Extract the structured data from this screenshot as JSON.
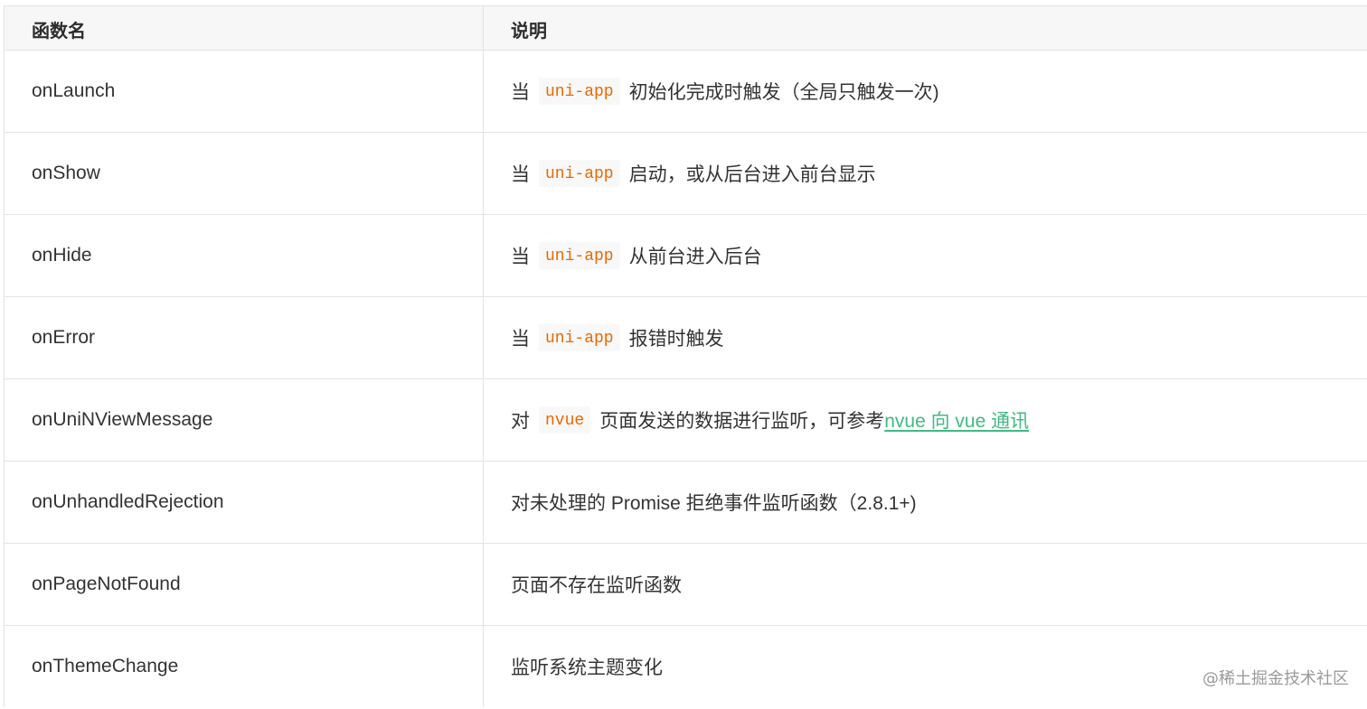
{
  "table": {
    "headers": {
      "name": "函数名",
      "desc": "说明"
    },
    "rows": [
      {
        "name": "onLaunch",
        "pre": "当",
        "code": "uni-app",
        "post": "初始化完成时触发（全局只触发一次)"
      },
      {
        "name": "onShow",
        "pre": "当",
        "code": "uni-app",
        "post": "启动，或从后台进入前台显示"
      },
      {
        "name": "onHide",
        "pre": "当",
        "code": "uni-app",
        "post": "从前台进入后台"
      },
      {
        "name": "onError",
        "pre": "当",
        "code": "uni-app",
        "post": "报错时触发"
      },
      {
        "name": "onUniNViewMessage",
        "pre": "对",
        "code": "nvue",
        "post": "页面发送的数据进行监听，可参考",
        "link": "nvue 向 vue 通讯"
      },
      {
        "name": "onUnhandledRejection",
        "text": "对未处理的 Promise 拒绝事件监听函数（2.8.1+)"
      },
      {
        "name": "onPageNotFound",
        "text": "页面不存在监听函数"
      },
      {
        "name": "onThemeChange",
        "text": "监听系统主题变化"
      }
    ]
  },
  "watermark": "@稀土掘金技术社区",
  "colors": {
    "code_text": "#e96900",
    "code_bg": "#f8f8f8",
    "link": "#42b983",
    "header_bg": "#f7f7f7",
    "border": "#e3e3e3"
  }
}
